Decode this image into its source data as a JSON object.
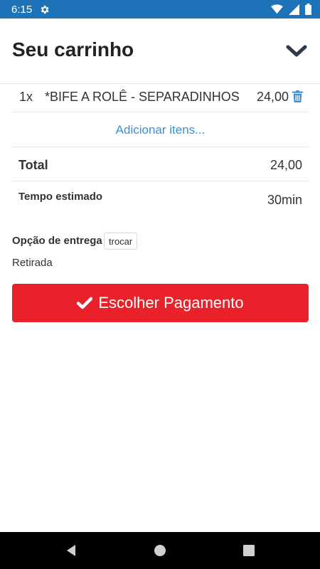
{
  "status_bar": {
    "time": "6:15",
    "icons": [
      "gear-icon",
      "wifi-icon",
      "signal-icon",
      "battery-icon"
    ],
    "color": "#1e73b8"
  },
  "header": {
    "title": "Seu carrinho",
    "collapse_icon": "chevron-down-icon"
  },
  "cart": {
    "items": [
      {
        "qty": "1x",
        "name": "*BIFE A ROLÊ - SEPARADINHOS",
        "price": "24,00",
        "delete_icon": "trash-icon"
      }
    ],
    "add_items_label": "Adicionar itens...",
    "total_label": "Total",
    "total_value": "24,00",
    "time_label": "Tempo estimado",
    "time_value": "30min"
  },
  "delivery": {
    "label": "Opção de entrega",
    "swap_label": "trocar",
    "value": "Retirada"
  },
  "payment_button": {
    "label": "Escolher Pagamento",
    "icon": "check-icon",
    "color": "#e8212b"
  },
  "link_color": "#3a8fd9",
  "nav_bar": {
    "icons": [
      "back-icon",
      "home-icon",
      "recent-apps-icon"
    ]
  }
}
